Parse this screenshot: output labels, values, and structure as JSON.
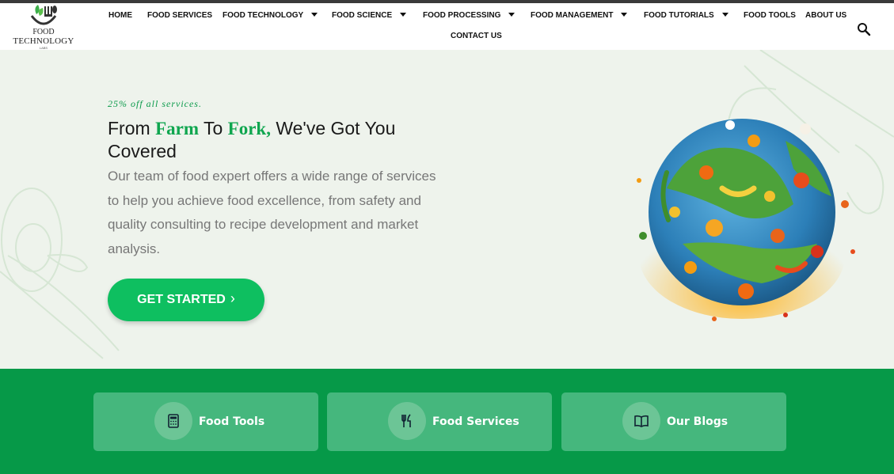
{
  "logo": {
    "line1": "FOOD",
    "line2": "TECHNOLOGY",
    "line3": "LABS",
    "icon": "fork-spoon-leaf-icon"
  },
  "nav": {
    "home": "HOME",
    "food_services": "FOOD SERVICES",
    "food_technology": "FOOD TECHNOLOGY",
    "food_science": "FOOD SCIENCE",
    "food_processing": "FOOD PROCESSING",
    "food_management": "FOOD MANAGEMENT",
    "food_tutorials": "FOOD TUTORIALS",
    "food_tools": "FOOD TOOLS",
    "about_us": "ABOUT US",
    "contact_us": "CONTACT US"
  },
  "search_icon": "search-icon",
  "hero": {
    "promo": "25% off all services.",
    "title_part1": "From ",
    "title_hl1": "Farm",
    "title_part2": " To ",
    "title_hl2": "Fork,",
    "title_part3": " We've Got You Covered",
    "description": "Our team of food expert offers a wide range of services to help you achieve food excellence, from safety and quality consulting to recipe development and market analysis.",
    "cta_label": "GET STARTED",
    "cta_chevron": "›"
  },
  "cards": [
    {
      "label": "Food Tools",
      "icon": "calculator-icon"
    },
    {
      "label": "Food Services",
      "icon": "utensils-icon"
    },
    {
      "label": "Our Blogs",
      "icon": "book-icon"
    }
  ],
  "colors": {
    "accent": "#0fa64f",
    "button": "#0ebf60",
    "band": "#069948",
    "card": "#45b77d",
    "hero_bg": "#eef3ec"
  }
}
